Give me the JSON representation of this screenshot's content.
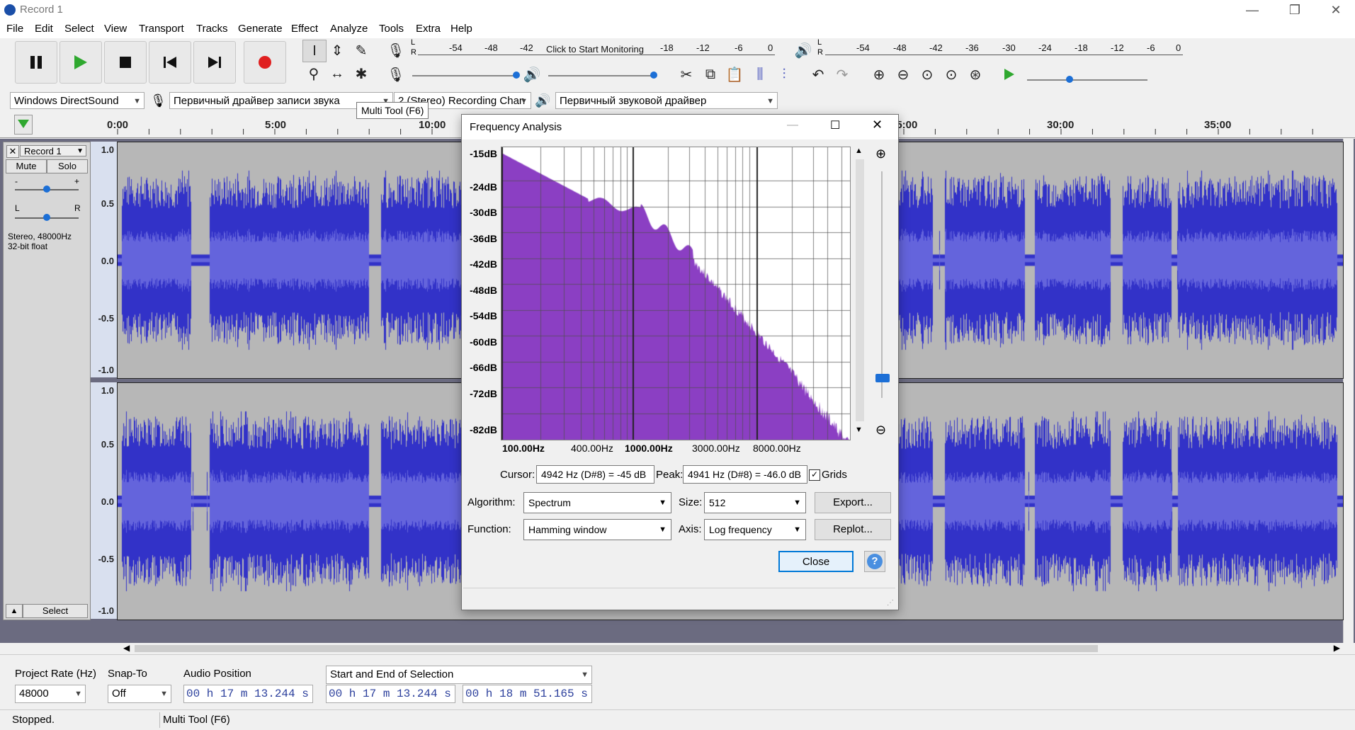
{
  "window": {
    "title": "Record 1",
    "controls": [
      "—",
      "❐",
      "✕"
    ]
  },
  "menu": [
    "File",
    "Edit",
    "Select",
    "View",
    "Transport",
    "Tracks",
    "Generate",
    "Effect",
    "Analyze",
    "Tools",
    "Extra",
    "Help"
  ],
  "meters": {
    "record_scale": [
      "-54",
      "-48",
      "-42",
      "Click to Start Monitoring",
      "-18",
      "-12",
      "-6",
      "0"
    ],
    "play_scale": [
      "-54",
      "-48",
      "-42",
      "-36",
      "-30",
      "-24",
      "-18",
      "-12",
      "-6",
      "0"
    ],
    "L": "L",
    "R": "R"
  },
  "device": {
    "host": "Windows DirectSound",
    "record_device": "Первичный драйвер записи звука",
    "channels": "2 (Stereo) Recording Chan",
    "playback_device": "Первичный звуковой драйвер"
  },
  "tooltip": "Multi Tool (F6)",
  "timeline": [
    "0:00",
    "5:00",
    "10:00",
    "25:00",
    "30:00",
    "35:00"
  ],
  "track": {
    "name": "Record 1",
    "mute": "Mute",
    "solo": "Solo",
    "gain_minus": "-",
    "gain_plus": "+",
    "pan_l": "L",
    "pan_r": "R",
    "info1": "Stereo, 48000Hz",
    "info2": "32-bit float",
    "select": "Select",
    "ruler": [
      "1.0",
      "0.5",
      "0.0",
      "-0.5",
      "-1.0"
    ]
  },
  "dialog": {
    "title": "Frequency Analysis",
    "db_labels": [
      "-15dB",
      "-24dB",
      "-30dB",
      "-36dB",
      "-42dB",
      "-48dB",
      "-54dB",
      "-60dB",
      "-66dB",
      "-72dB",
      "-82dB"
    ],
    "hz_labels": [
      "100.00Hz",
      "400.00Hz",
      "1000.00Hz",
      "3000.00Hz",
      "8000.00Hz"
    ],
    "cursor_label": "Cursor:",
    "cursor_value": "4942 Hz (D#8) = -45 dB",
    "peak_label": "Peak:",
    "peak_value": "4941 Hz (D#8) = -46.0 dB",
    "grids_label": "Grids",
    "algorithm_label": "Algorithm:",
    "algorithm_value": "Spectrum",
    "size_label": "Size:",
    "size_value": "512",
    "function_label": "Function:",
    "function_value": "Hamming window",
    "axis_label": "Axis:",
    "axis_value": "Log frequency",
    "export_label": "Export...",
    "replot_label": "Replot...",
    "close_label": "Close",
    "help_label": "?",
    "spectrum_color": "#8b3fc3"
  },
  "bottom": {
    "rate_label": "Project Rate (Hz)",
    "rate_value": "48000",
    "snap_label": "Snap-To",
    "snap_value": "Off",
    "audio_pos_label": "Audio Position",
    "audio_pos_value": "00 h 17 m 13.244 s",
    "selection_mode": "Start and End of Selection",
    "sel_start": "00 h 17 m 13.244 s",
    "sel_end": "00 h 18 m 51.165 s"
  },
  "status": {
    "left": "Stopped.",
    "right": "Multi Tool (F6)"
  },
  "colors": {
    "waveform": "#3232c8",
    "waveform_rms": "#6464dc",
    "accent_record": "#e02020",
    "play_green": "#2fa82f"
  }
}
